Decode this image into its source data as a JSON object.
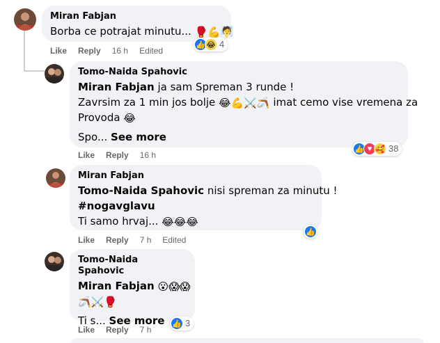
{
  "comments": [
    {
      "author": "Miran Fabjan",
      "lines": [
        [
          "Borba ce potrajat minutu... ",
          "🥊💪🧖"
        ]
      ],
      "actions": {
        "like": "Like",
        "reply": "Reply",
        "time": "16 h",
        "edited": "Edited"
      },
      "reaction_count": "4"
    },
    {
      "author": "Tomo-Naida Spahovic",
      "mention": "Miran Fabjan",
      "line1_rest": " ja sam Spreman 3 runde !",
      "line2": "Zavrsim za 1 min jos bolje ",
      "line2_emoji": "😂💪⚔️🪃",
      "line2_rest": " imat cemo vise vremena za",
      "line3": "Provoda ",
      "line3_emoji": "😂",
      "truncated": "Spo... ",
      "see_more": "See more",
      "actions": {
        "like": "Like",
        "reply": "Reply",
        "time": "16 h"
      },
      "reaction_count": "38"
    },
    {
      "author": "Miran Fabjan",
      "mention": "Tomo-Naida Spahovic",
      "line1_rest": " nisi spreman za minutu !",
      "hashtag": "#nogavglavu",
      "line3": "Ti samo hrvaj... ",
      "line3_emoji": "😂😂😂",
      "actions": {
        "like": "Like",
        "reply": "Reply",
        "time": "7 h",
        "edited": "Edited"
      }
    },
    {
      "author": "Tomo-Naida Spahovic",
      "mention": "Miran Fabjan",
      "line1_emoji": "😮😱😱",
      "line2_emoji": "🪃⚔️🥊",
      "truncated": "Ti s... ",
      "see_more": "See more",
      "actions": {
        "like": "Like",
        "reply": "Reply",
        "time": "7 h"
      },
      "reaction_count": "3"
    }
  ],
  "colors": {
    "bubble": "#f0f2f5",
    "like_blue": "#1877f2",
    "love_red": "#f33e58",
    "haha_yellow": "#fcd34d",
    "meta_gray": "#65676b"
  }
}
